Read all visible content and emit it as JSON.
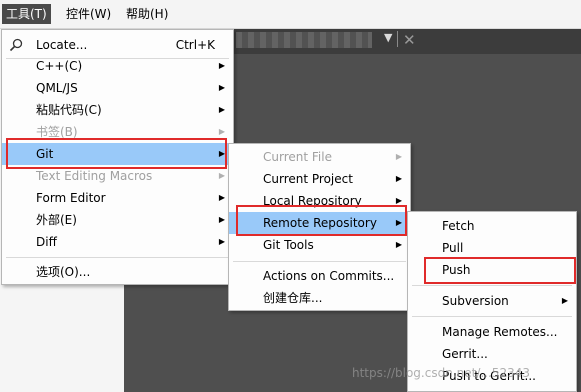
{
  "menubar": {
    "items": [
      "工具(T)",
      "控件(W)",
      "帮助(H)"
    ]
  },
  "tools_menu": {
    "items": [
      {
        "label": "Locate...",
        "shortcut": "Ctrl+K"
      },
      {
        "label": "C++(C)"
      },
      {
        "label": "QML/JS"
      },
      {
        "label": "粘贴代码(C)"
      },
      {
        "label": "书签(B)"
      },
      {
        "label": "Git"
      },
      {
        "label": "Text Editing Macros"
      },
      {
        "label": "Form Editor"
      },
      {
        "label": "外部(E)"
      },
      {
        "label": "Diff"
      },
      {
        "label": "选项(O)..."
      }
    ]
  },
  "git_menu": {
    "items": [
      {
        "label": "Current File"
      },
      {
        "label": "Current Project"
      },
      {
        "label": "Local Repository"
      },
      {
        "label": "Remote Repository"
      },
      {
        "label": "Git Tools"
      },
      {
        "label": "Actions on Commits..."
      },
      {
        "label": "创建仓库..."
      }
    ]
  },
  "remote_menu": {
    "items": [
      {
        "label": "Fetch"
      },
      {
        "label": "Pull"
      },
      {
        "label": "Push"
      },
      {
        "label": "Subversion"
      },
      {
        "label": "Manage Remotes..."
      },
      {
        "label": "Gerrit..."
      },
      {
        "label": "Push to Gerrit..."
      }
    ]
  },
  "watermark": "https://blog.csdn.net/...52343",
  "colors": {
    "highlight": "#99c9f9",
    "annotation_red": "#e02a2a",
    "disabled_text": "#a0a0a0"
  }
}
